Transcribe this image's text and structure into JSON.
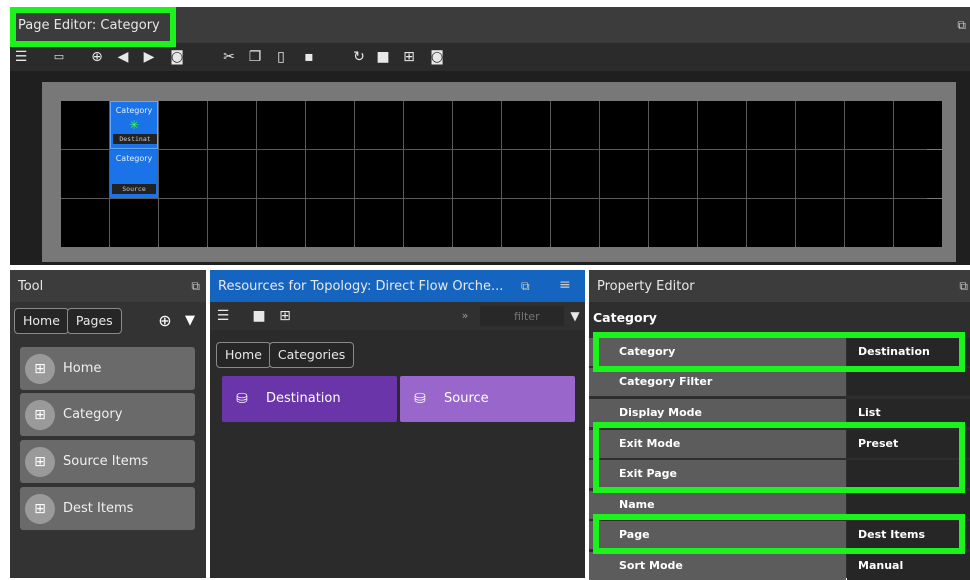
{
  "page_editor": {
    "title": "Page Editor: Category",
    "undock_icon": "undock-icon",
    "toolbar_icons": [
      "list-icon",
      "card-icon",
      "add-icon",
      "back-icon",
      "forward-icon",
      "tag-icon",
      "cut-icon",
      "copy-icon",
      "paste-icon",
      "move-icon",
      "refresh-icon",
      "grid-large-icon",
      "grid-small-icon",
      "tag-icon"
    ],
    "cells": [
      {
        "category": "Category",
        "sub": "Destinat"
      },
      {
        "category": "Category",
        "sub": "Source"
      }
    ]
  },
  "tool": {
    "title": "Tool",
    "breadcrumb": [
      "Home",
      "Pages"
    ],
    "items": [
      {
        "label": "Home"
      },
      {
        "label": "Category"
      },
      {
        "label": "Source Items"
      },
      {
        "label": "Dest Items"
      }
    ]
  },
  "resources": {
    "title": "Resources for Topology: Direct Flow Orche...",
    "filter_placeholder": "filter",
    "breadcrumb": [
      "Home",
      "Categories"
    ],
    "tiles": [
      {
        "label": "Destination",
        "color": "#6a35a8"
      },
      {
        "label": "Source",
        "color": "#9966cc"
      }
    ]
  },
  "property_editor": {
    "title": "Property Editor",
    "section": "Category",
    "rows": [
      {
        "key": "Category",
        "value": "Destination"
      },
      {
        "key": "Category Filter",
        "value": ""
      },
      {
        "key": "Display Mode",
        "value": "List"
      },
      {
        "key": "Exit Mode",
        "value": "Preset"
      },
      {
        "key": "Exit Page",
        "value": ""
      },
      {
        "key": "Name",
        "value": ""
      },
      {
        "key": "Page",
        "value": "Dest Items"
      },
      {
        "key": "Sort Mode",
        "value": "Manual"
      }
    ]
  },
  "colors": {
    "highlight": "#1cf21c",
    "selection_blue": "#1a73e8",
    "resources_header": "#1565c0"
  }
}
